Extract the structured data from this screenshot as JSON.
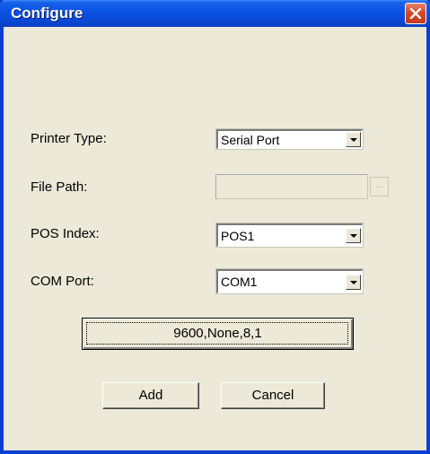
{
  "window": {
    "title": "Configure"
  },
  "form": {
    "printer_type_label": "Printer Type:",
    "printer_type_value": "Serial Port",
    "file_path_label": "File Path:",
    "file_path_value": "",
    "browse_label": "...",
    "pos_index_label": "POS Index:",
    "pos_index_value": "POS1",
    "com_port_label": "COM Port:",
    "com_port_value": "COM1"
  },
  "buttons": {
    "settings_label": "9600,None,8,1",
    "add_label": "Add",
    "cancel_label": "Cancel"
  },
  "icons": {
    "close": "close-icon",
    "dropdown": "chevron-down-icon"
  },
  "colors": {
    "title_bar": "#0a53e5",
    "close_button": "#d6492a",
    "dialog_background": "#ece9d8"
  }
}
